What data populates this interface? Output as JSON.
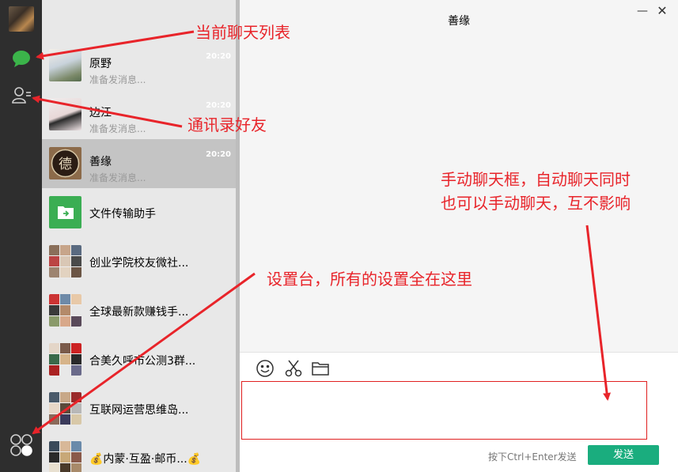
{
  "window": {
    "title": "善缘"
  },
  "chats": [
    {
      "name": "原野",
      "preview": "准备发消息...",
      "time": "20:20",
      "active": false
    },
    {
      "name": "边江",
      "preview": "准备发消息...",
      "time": "20:20",
      "active": false
    },
    {
      "name": "善缘",
      "preview": "准备发消息...",
      "time": "20:20",
      "active": true
    },
    {
      "name": "文件传输助手",
      "preview": "",
      "time": "",
      "active": false
    },
    {
      "name": "创业学院校友微社...",
      "preview": "",
      "time": "",
      "active": false
    },
    {
      "name": "全球最新款赚钱手...",
      "preview": "",
      "time": "",
      "active": false
    },
    {
      "name": "合美久呼市公测3群...",
      "preview": "",
      "time": "",
      "active": false
    },
    {
      "name": "互联网运营思维岛...",
      "preview": "",
      "time": "",
      "active": false
    },
    {
      "name": "💰内蒙·互盈·邮币...💰",
      "preview": "",
      "time": "",
      "active": false
    }
  ],
  "compose": {
    "hint": "按下Ctrl+Enter发送",
    "send_label": "发送"
  },
  "annotations": {
    "chat_list": "当前聊天列表",
    "contacts": "通讯录好友",
    "manual_chat_line1": "手动聊天框，自动聊天同时",
    "manual_chat_line2": "也可以手动聊天，互不影响",
    "settings": "设置台，所有的设置全在这里"
  },
  "colors": {
    "rail": "#2e2e2e",
    "chat_icon_green": "#3bb44a",
    "send_button": "#1aad7e",
    "annotation_red": "#e8242a"
  },
  "icons": {
    "chat": "chat-bubble-icon",
    "contacts": "contacts-icon",
    "settings": "settings-icon",
    "emoji": "emoji-icon",
    "scissors": "scissors-icon",
    "folder": "folder-icon",
    "file_transfer": "file-transfer-icon"
  }
}
